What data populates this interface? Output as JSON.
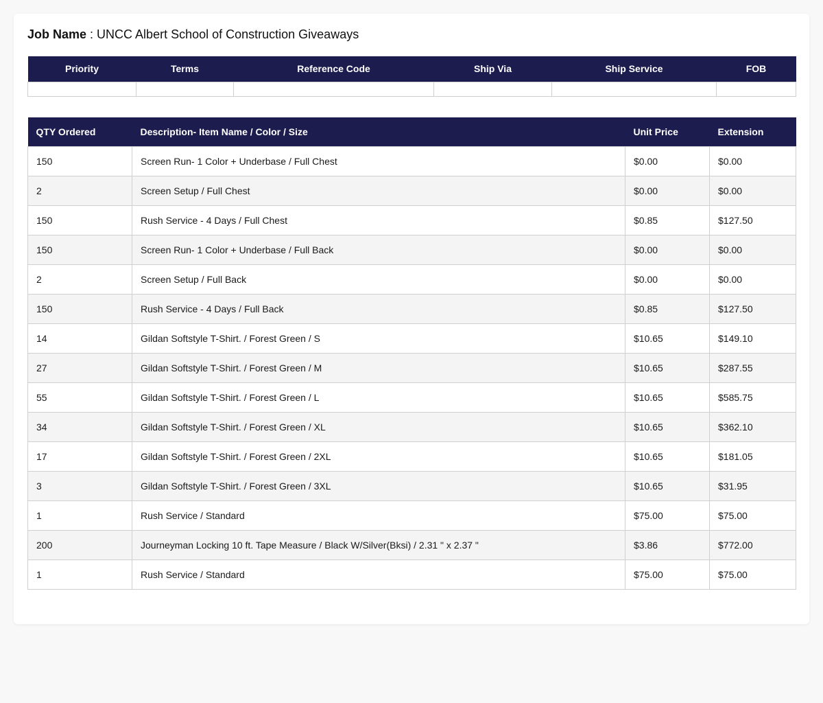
{
  "job": {
    "label": "Job Name",
    "separator": " : ",
    "name": "UNCC Albert School of Construction Giveaways"
  },
  "meta_table": {
    "headers": [
      "Priority",
      "Terms",
      "Reference Code",
      "Ship Via",
      "Ship Service",
      "FOB"
    ],
    "values": [
      "",
      "",
      "",
      "",
      "",
      ""
    ]
  },
  "items_table": {
    "headers": [
      "QTY Ordered",
      "Description- Item Name / Color / Size",
      "Unit Price",
      "Extension"
    ],
    "rows": [
      {
        "qty": "150",
        "description": "Screen Run- 1 Color + Underbase / Full Chest",
        "unit_price": "$0.00",
        "extension": "$0.00"
      },
      {
        "qty": "2",
        "description": "Screen Setup / Full Chest",
        "unit_price": "$0.00",
        "extension": "$0.00"
      },
      {
        "qty": "150",
        "description": "Rush Service - 4 Days / Full Chest",
        "unit_price": "$0.85",
        "extension": "$127.50"
      },
      {
        "qty": "150",
        "description": "Screen Run- 1 Color + Underbase / Full Back",
        "unit_price": "$0.00",
        "extension": "$0.00"
      },
      {
        "qty": "2",
        "description": "Screen Setup / Full Back",
        "unit_price": "$0.00",
        "extension": "$0.00"
      },
      {
        "qty": "150",
        "description": "Rush Service - 4 Days / Full Back",
        "unit_price": "$0.85",
        "extension": "$127.50"
      },
      {
        "qty": "14",
        "description": "Gildan Softstyle T-Shirt. / Forest Green / S",
        "unit_price": "$10.65",
        "extension": "$149.10"
      },
      {
        "qty": "27",
        "description": "Gildan Softstyle T-Shirt. / Forest Green / M",
        "unit_price": "$10.65",
        "extension": "$287.55"
      },
      {
        "qty": "55",
        "description": "Gildan Softstyle T-Shirt. / Forest Green / L",
        "unit_price": "$10.65",
        "extension": "$585.75"
      },
      {
        "qty": "34",
        "description": "Gildan Softstyle T-Shirt. / Forest Green / XL",
        "unit_price": "$10.65",
        "extension": "$362.10"
      },
      {
        "qty": "17",
        "description": "Gildan Softstyle T-Shirt. / Forest Green / 2XL",
        "unit_price": "$10.65",
        "extension": "$181.05"
      },
      {
        "qty": "3",
        "description": "Gildan Softstyle T-Shirt. / Forest Green / 3XL",
        "unit_price": "$10.65",
        "extension": "$31.95"
      },
      {
        "qty": "1",
        "description": "Rush Service / Standard",
        "unit_price": "$75.00",
        "extension": "$75.00"
      },
      {
        "qty": "200",
        "description": "Journeyman Locking 10 ft. Tape Measure / Black W/Silver(Bksi) / 2.31 \" x 2.37 \"",
        "unit_price": "$3.86",
        "extension": "$772.00"
      },
      {
        "qty": "1",
        "description": "Rush Service / Standard",
        "unit_price": "$75.00",
        "extension": "$75.00"
      }
    ]
  },
  "colors": {
    "header_bg": "#1c1c4e",
    "header_text": "#ffffff",
    "row_alt_bg": "#f4f4f4",
    "border": "#cfcfcf"
  }
}
